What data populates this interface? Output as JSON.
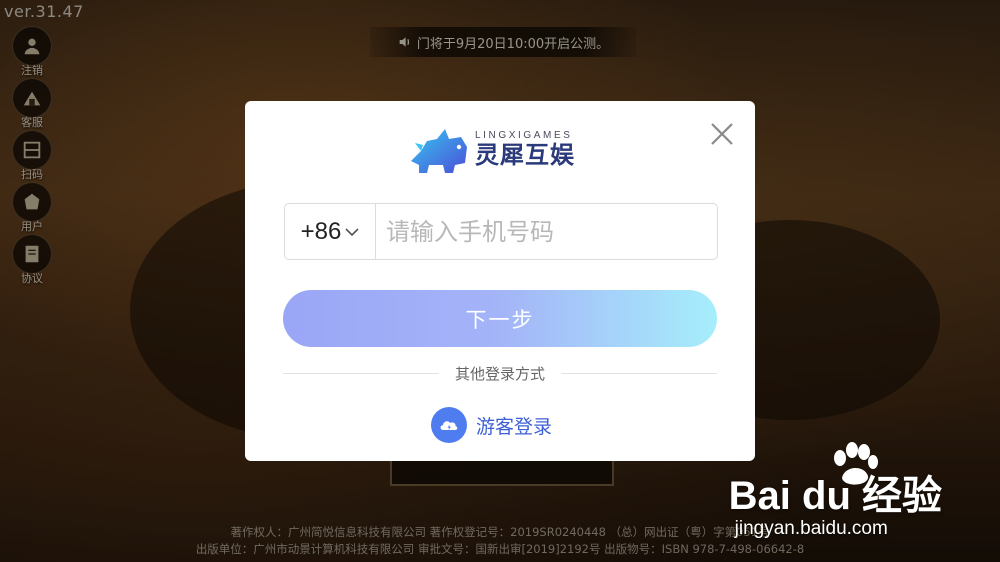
{
  "app": {
    "version": "ver.31.47",
    "notice": "门将于9月20日10:00开启公测。"
  },
  "side_menu": [
    {
      "label": "注销",
      "icon": "user-logout-icon"
    },
    {
      "label": "客服",
      "icon": "customer-service-icon"
    },
    {
      "label": "扫码",
      "icon": "scan-code-icon"
    },
    {
      "label": "用户",
      "icon": "user-center-icon"
    },
    {
      "label": "协议",
      "icon": "agreement-icon"
    }
  ],
  "dialog": {
    "brand_en": "LINGXIGAMES",
    "brand_cn": "灵犀互娱",
    "country_code": "+86",
    "phone_placeholder": "请输入手机号码",
    "phone_value": "",
    "next_label": "下一步",
    "other_login_label": "其他登录方式",
    "guest_login_label": "游客登录",
    "colors": {
      "button_start": "#9aa6f6",
      "button_end": "#a6eefb",
      "guest_icon": "#4f7df0",
      "guest_text": "#3d5fd6"
    }
  },
  "footer": {
    "line1": "著作权人：广州简悦信息科技有限公司    著作权登记号：2019SR0240448    （总）网出证（粤）字第051号",
    "line2": "出版单位：广州市动景计算机科技有限公司 审批文号：国新出审[2019]2192号 出版物号：ISBN 978-7-498-06642-8"
  },
  "watermark": {
    "logo": "Bai du 经验",
    "url": "jingyan.baidu.com"
  }
}
